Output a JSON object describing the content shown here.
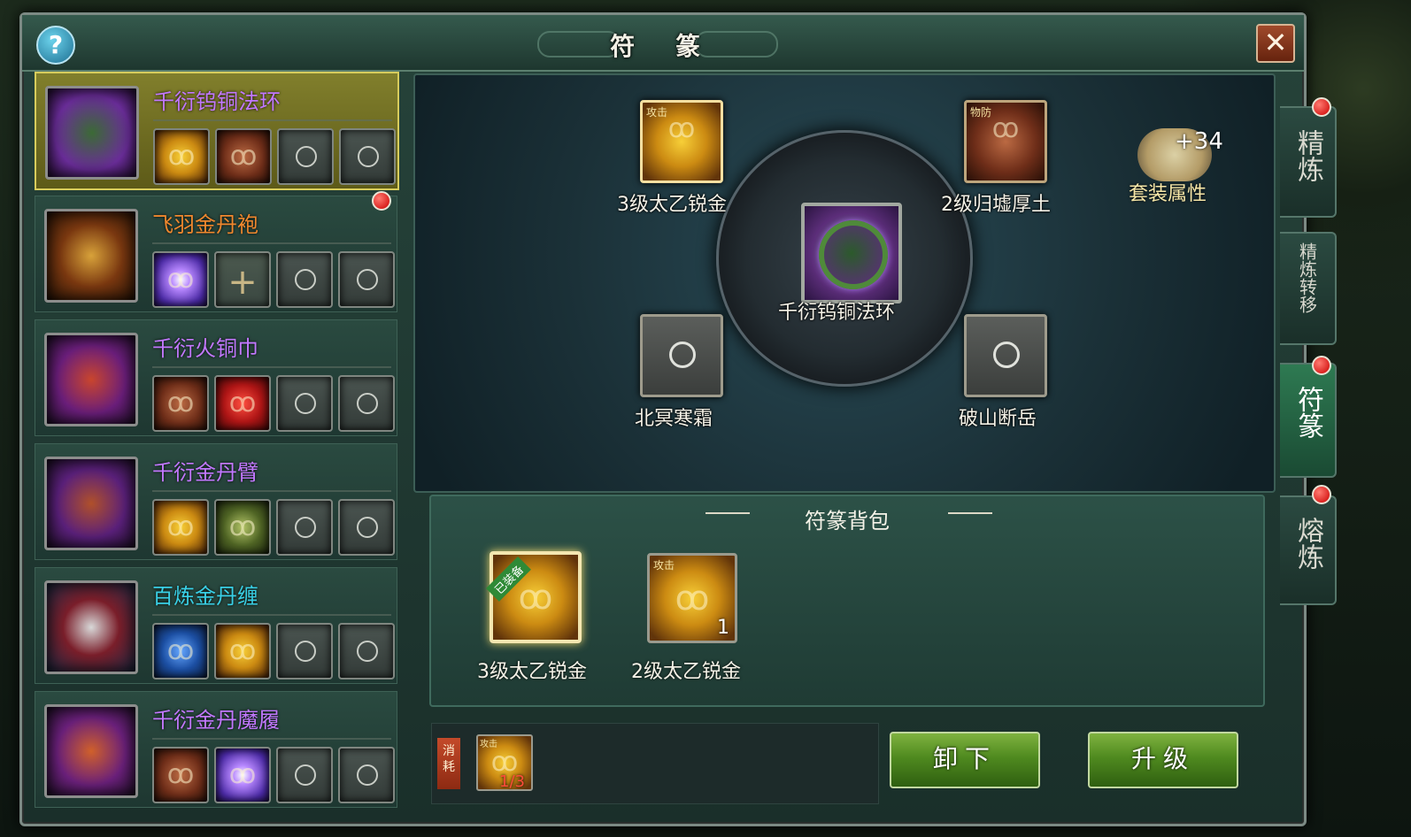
{
  "window": {
    "title": "符 篆",
    "help_label": "?",
    "close_label": "✕"
  },
  "equipment": [
    {
      "name": "千衍钨铜法环",
      "color": "#c278ff",
      "selected": true
    },
    {
      "name": "飞羽金丹袍",
      "color": "#f0882e",
      "selected": false,
      "red_dot": true
    },
    {
      "name": "千衍火铜巾",
      "color": "#c278ff",
      "selected": false
    },
    {
      "name": "千衍金丹臂",
      "color": "#c278ff",
      "selected": false
    },
    {
      "name": "百炼金丹缠",
      "color": "#39d0e6",
      "selected": false
    },
    {
      "name": "千衍金丹魔履",
      "color": "#c278ff",
      "selected": false
    }
  ],
  "sockets": {
    "top_left": {
      "tag": "攻击",
      "label": "3级太乙锐金"
    },
    "top_right": {
      "tag": "物防",
      "label": "2级归墟厚土"
    },
    "center": {
      "label": "千衍钨铜法环"
    },
    "bottom_left": {
      "label": "北冥寒霜"
    },
    "bottom_right": {
      "label": "破山断岳"
    }
  },
  "set_attribute": {
    "plus": "+34",
    "label": "套装属性"
  },
  "bag": {
    "title": "符篆背包",
    "items": [
      {
        "label": "3级太乙锐金",
        "equipped_tag": "已装备",
        "selected": true
      },
      {
        "label": "2级太乙锐金",
        "tag": "攻击",
        "count": "1",
        "selected": false
      }
    ]
  },
  "cost": {
    "tag": "消耗",
    "item_tag": "攻击",
    "count": "1/3"
  },
  "buttons": {
    "unequip": "卸下",
    "upgrade": "升级"
  },
  "side_tabs": [
    {
      "label": "精炼",
      "red_dot": true
    },
    {
      "label": "精炼转移",
      "red_dot": false
    },
    {
      "label": "符篆",
      "red_dot": true,
      "active": true
    },
    {
      "label": "熔炼",
      "red_dot": true
    }
  ]
}
